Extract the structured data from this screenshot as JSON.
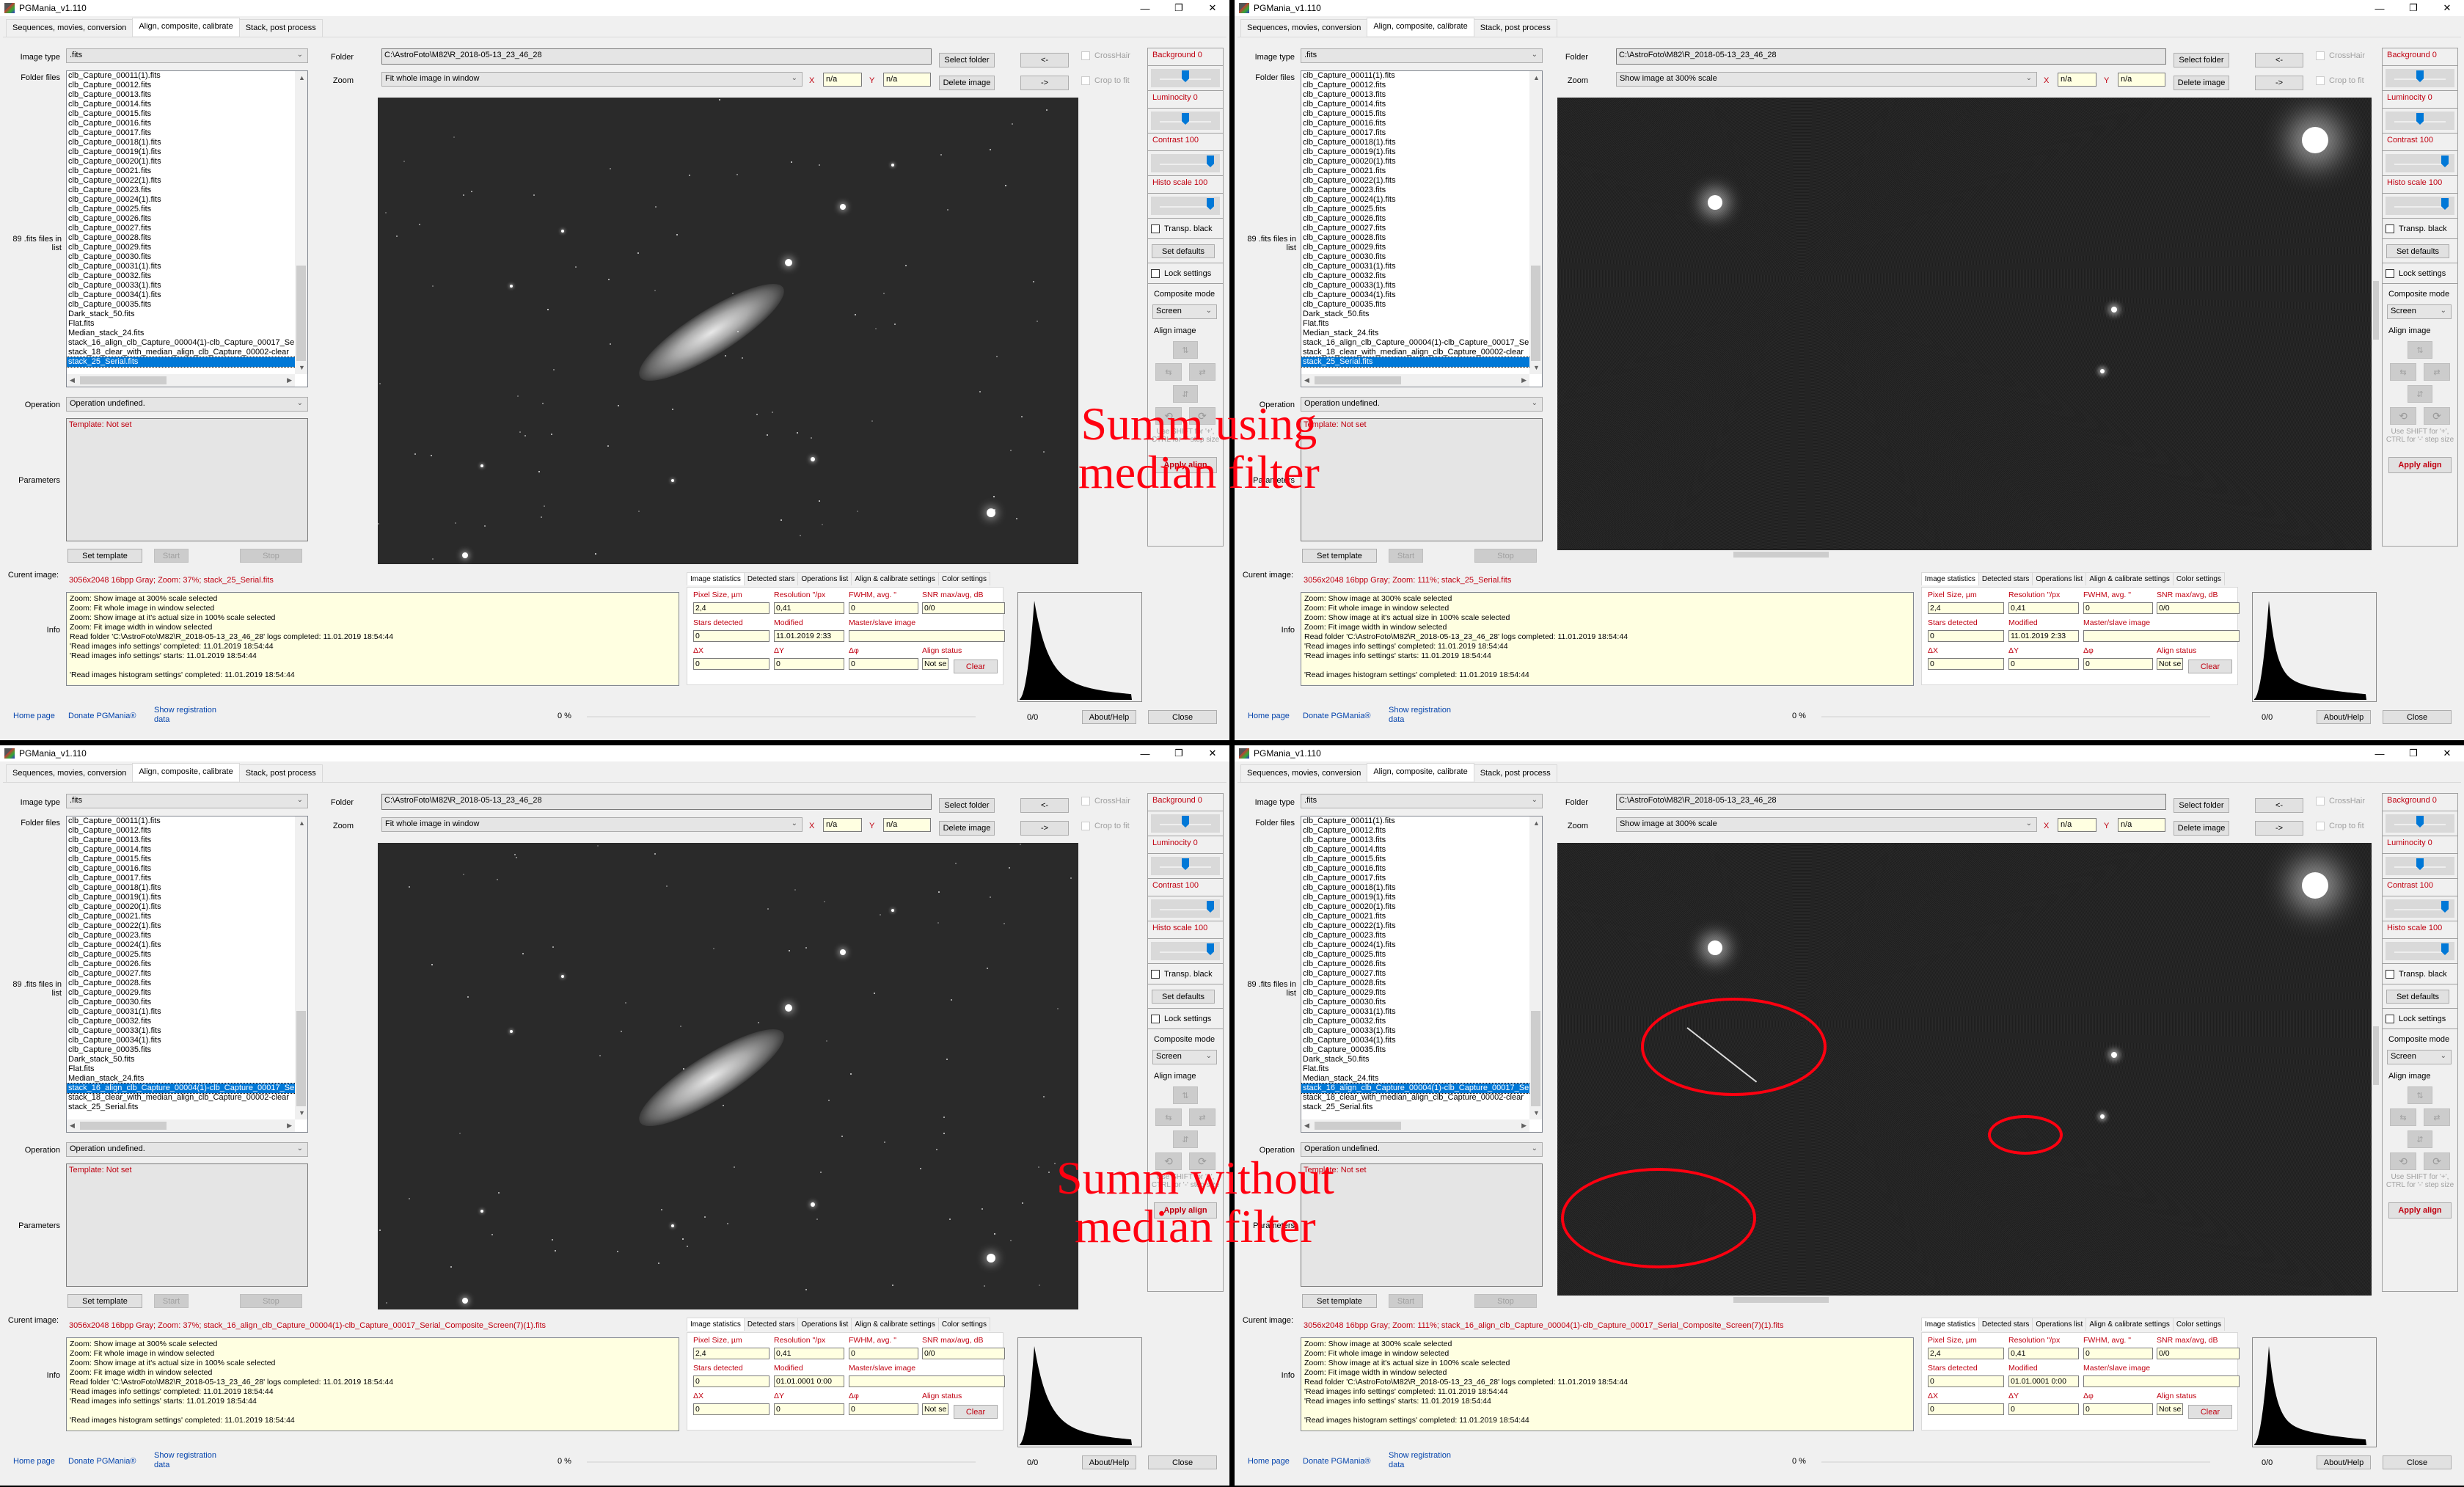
{
  "app_title": "PGMania_v1.110",
  "window_controls": {
    "minimize": "—",
    "restore": "❐",
    "close": "✕"
  },
  "tabs": [
    "Sequences, movies, conversion",
    "Align, composite, calibrate",
    "Stack, post process"
  ],
  "active_tab": 1,
  "labels": {
    "image_type": "Image type",
    "folder_files": "Folder files",
    "file_count": "89 .fits files in list",
    "operation": "Operation",
    "parameters": "Parameters",
    "current_image": "Curent image:",
    "info": "Info",
    "folder": "Folder",
    "zoom": "Zoom",
    "x": "X",
    "y": "Y"
  },
  "image_type_value": ".fits",
  "folder_value": "C:\\AstroFoto\\M82\\R_2018-05-13_23_46_28",
  "operation_value": "Operation undefined.",
  "template_text": "Template: Not set",
  "x_value": "n/a",
  "y_value": "n/a",
  "buttons": {
    "select_folder": "Select folder",
    "delete_image": "Delete image",
    "prev": "<-",
    "next": "->",
    "set_template": "Set template",
    "start": "Start",
    "stop": "Stop",
    "set_defaults": "Set defaults",
    "apply_align": "Apply align",
    "clear": "Clear",
    "about_help": "About/Help",
    "close": "Close"
  },
  "checkboxes": {
    "crosshair": "CrossHair",
    "crop_to_fit": "Crop to fit",
    "transp_black": "Transp. black",
    "lock_settings": "Lock settings"
  },
  "sliders": [
    {
      "label": "Background 0",
      "value": 0,
      "fraction": 0.5
    },
    {
      "label": "Luminocity 0",
      "value": 0,
      "fraction": 0.5
    },
    {
      "label": "Contrast 100",
      "value": 100,
      "fraction": 1.0
    },
    {
      "label": "Histo scale 100",
      "value": 100,
      "fraction": 1.0
    }
  ],
  "composite_mode_label": "Composite mode",
  "composite_mode_value": "Screen",
  "align_image_label": "Align image",
  "align_hint": "Use SHIFT for '+', CTRL for '-' step size",
  "files": [
    "clb_Capture_00011(1).fits",
    "clb_Capture_00012.fits",
    "clb_Capture_00013.fits",
    "clb_Capture_00014.fits",
    "clb_Capture_00015.fits",
    "clb_Capture_00016.fits",
    "clb_Capture_00017.fits",
    "clb_Capture_00018(1).fits",
    "clb_Capture_00019(1).fits",
    "clb_Capture_00020(1).fits",
    "clb_Capture_00021.fits",
    "clb_Capture_00022(1).fits",
    "clb_Capture_00023.fits",
    "clb_Capture_00024(1).fits",
    "clb_Capture_00025.fits",
    "clb_Capture_00026.fits",
    "clb_Capture_00027.fits",
    "clb_Capture_00028.fits",
    "clb_Capture_00029.fits",
    "clb_Capture_00030.fits",
    "clb_Capture_00031(1).fits",
    "clb_Capture_00032.fits",
    "clb_Capture_00033(1).fits",
    "clb_Capture_00034(1).fits",
    "clb_Capture_00035.fits",
    "Dark_stack_50.fits",
    "Flat.fits",
    "Median_stack_24.fits",
    "stack_16_align_clb_Capture_00004(1)-clb_Capture_00017_Serial_Composite_Screen(7)(1).fits",
    "stack_18_clear_with_median_align_clb_Capture_00002-clear",
    "stack_25_Serial.fits"
  ],
  "info_log": [
    "Zoom: Show image at 300% scale selected",
    "Zoom: Fit whole image in window selected",
    "Zoom: Show image at it's actual size in 100% scale selected",
    "Zoom: Fit image width in window selected",
    "Read folder 'C:\\AstroFoto\\M82\\R_2018-05-13_23_46_28' logs completed: 11.01.2019 18:54:44",
    "'Read images info settings' completed: 11.01.2019 18:54:44",
    "'Read images info settings' starts: 11.01.2019 18:54:44",
    "",
    "'Read images histogram settings' completed: 11.01.2019 18:54:44"
  ],
  "stats_tabs": [
    "Image statistics",
    "Detected stars",
    "Operations list",
    "Align & calibrate settings",
    "Color settings"
  ],
  "stats_labels": {
    "pixel_size": "Pixel Size, µm",
    "resolution": "Resolution \"/px",
    "fwhm": "FWHM, avg. \"",
    "snr": "SNR max/avg, dB",
    "stars_detected": "Stars detected",
    "modified": "Modified",
    "master_slave": "Master/slave image",
    "dx": "ΔX",
    "dy": "ΔY",
    "dphi": "Δφ",
    "align_status": "Align status"
  },
  "links": {
    "home": "Home page",
    "donate": "Donate PGMania®",
    "registration": "Show registration data"
  },
  "progress_text": "0 %",
  "progress_fraction": 0,
  "histo_counter": "0/0",
  "windows": [
    {
      "zoom_value": "Fit whole image in window",
      "selected_file": 30,
      "current_image": "3056x2048 16bpp Gray; Zoom: 37%; stack_25_Serial.fits",
      "view": "galaxy",
      "stats": {
        "pixel_size": "2,4",
        "resolution": "0,41",
        "fwhm": "0",
        "snr": "0/0",
        "stars_detected": "0",
        "modified": "11.01.2019 2:33",
        "master_slave": "",
        "dx": "0",
        "dy": "0",
        "dphi": "0",
        "align_status": "Not se"
      }
    },
    {
      "zoom_value": "Show image at 300% scale",
      "selected_file": 30,
      "current_image": "3056x2048 16bpp Gray; Zoom: 111%; stack_25_Serial.fits",
      "view": "zoomed",
      "stats": {
        "pixel_size": "2,4",
        "resolution": "0,41",
        "fwhm": "0",
        "snr": "0/0",
        "stars_detected": "0",
        "modified": "11.01.2019 2:33",
        "master_slave": "",
        "dx": "0",
        "dy": "0",
        "dphi": "0",
        "align_status": "Not se"
      }
    },
    {
      "zoom_value": "Fit whole image in window",
      "selected_file": 28,
      "current_image": "3056x2048 16bpp Gray; Zoom: 37%; stack_16_align_clb_Capture_00004(1)-clb_Capture_00017_Serial_Composite_Screen(7)(1).fits",
      "view": "galaxy",
      "stats": {
        "pixel_size": "2,4",
        "resolution": "0,41",
        "fwhm": "0",
        "snr": "0/0",
        "stars_detected": "0",
        "modified": "01.01.0001 0:00",
        "master_slave": "",
        "dx": "0",
        "dy": "0",
        "dphi": "0",
        "align_status": "Not se"
      }
    },
    {
      "zoom_value": "Show image at 300% scale",
      "selected_file": 28,
      "current_image": "3056x2048 16bpp Gray; Zoom: 111%; stack_16_align_clb_Capture_00004(1)-clb_Capture_00017_Serial_Composite_Screen(7)(1).fits",
      "view": "zoomed",
      "stats": {
        "pixel_size": "2,4",
        "resolution": "0,41",
        "fwhm": "0",
        "snr": "0/0",
        "stars_detected": "0",
        "modified": "01.01.0001 0:00",
        "master_slave": "",
        "dx": "0",
        "dy": "0",
        "dphi": "0",
        "align_status": "Not se"
      }
    }
  ],
  "annotations": {
    "top_caption": "Summ using\nmedian filter",
    "bottom_caption": "Summ without\nmedian filter",
    "color": "#ff0010"
  },
  "colors": {
    "accent": "#0078d7",
    "label_red": "#c00010",
    "info_bg": "#ffffe1",
    "link": "#0645ad"
  }
}
